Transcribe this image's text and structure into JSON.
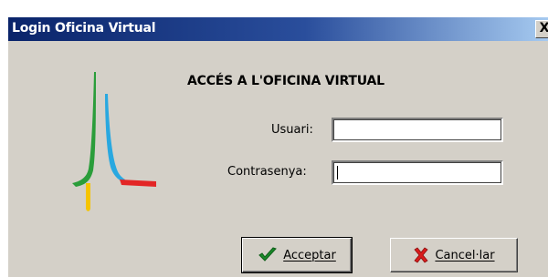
{
  "window": {
    "title": "Login Oficina Virtual",
    "close_glyph": "X"
  },
  "logo": {
    "icon": "peak-logo-icon",
    "colors": [
      "#2a9d3a",
      "#29a8e0",
      "#e32626",
      "#f5c400"
    ]
  },
  "form": {
    "heading": "ACCÉS A L'OFICINA VIRTUAL",
    "user_label": "Usuari:",
    "user_value": "",
    "password_label": "Contrasenya:",
    "password_value": ""
  },
  "buttons": {
    "accept_label": "Acceptar",
    "accept_icon": "checkmark-icon",
    "cancel_label": "Cancel·lar",
    "cancel_icon": "red-x-icon"
  }
}
